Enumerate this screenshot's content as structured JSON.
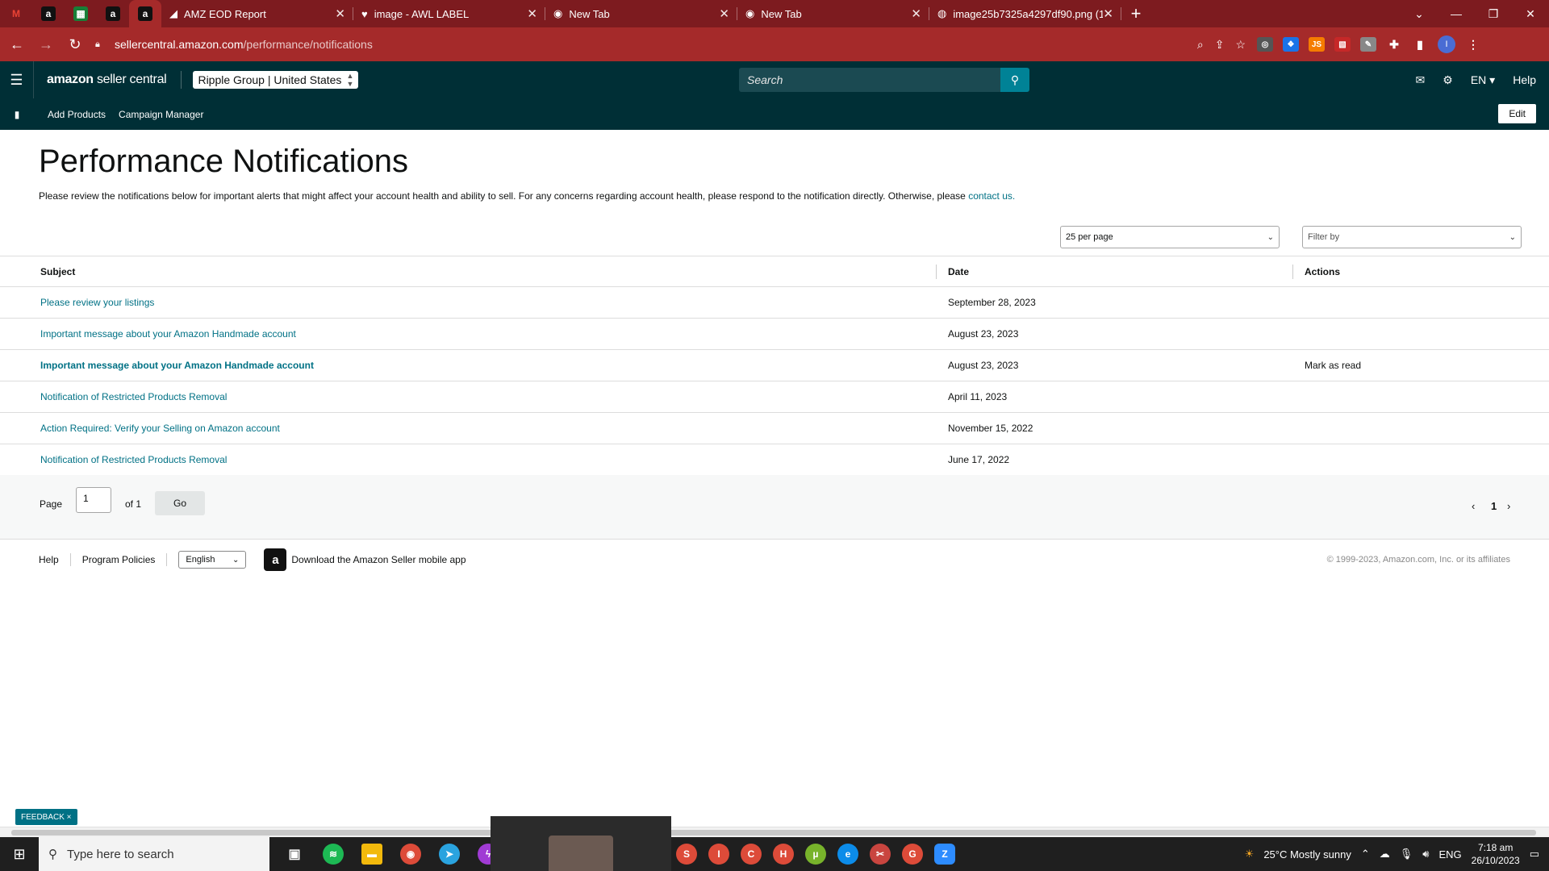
{
  "browser": {
    "pinned_tabs": [
      {
        "icon": "gmail-icon",
        "glyph": "M",
        "color": "#ea4335",
        "bg": "transparent"
      },
      {
        "icon": "amazon-icon",
        "glyph": "a",
        "color": "#fff",
        "bg": "#111"
      },
      {
        "icon": "sheets-icon",
        "glyph": "▦",
        "color": "#fff",
        "bg": "#188038"
      },
      {
        "icon": "amazon-icon",
        "glyph": "a",
        "color": "#fff",
        "bg": "#111"
      },
      {
        "icon": "amazon-icon",
        "glyph": "a",
        "color": "#fff",
        "bg": "#111"
      }
    ],
    "tabs": [
      {
        "title": "AMZ EOD Report",
        "icon": "clickup-icon"
      },
      {
        "title": "image - AWL LABEL",
        "icon": "heart-icon"
      },
      {
        "title": "New Tab",
        "icon": "chrome-icon"
      },
      {
        "title": "New Tab",
        "icon": "chrome-icon"
      },
      {
        "title": "image25b7325a4297df90.png (1",
        "icon": "globe-icon"
      }
    ],
    "url_host": "sellercentral.amazon.com",
    "url_path": "/performance/notifications",
    "profile_initial": "I"
  },
  "header": {
    "logo_bold": "amazon",
    "logo_light": "seller central",
    "account_name": "Ripple Group",
    "account_region": "United States",
    "search_placeholder": "Search",
    "language": "EN",
    "help": "Help"
  },
  "subnav": {
    "links": [
      "Add Products",
      "Campaign Manager"
    ],
    "edit": "Edit"
  },
  "main": {
    "title": "Performance Notifications",
    "description": "Please review the notifications below for important alerts that might affect your account health and ability to sell. For any concerns regarding account health, please respond to the notification directly. Otherwise, please",
    "contact_link": "contact us.",
    "per_page": "25 per page",
    "filter_placeholder": "Filter by",
    "table": {
      "headers": {
        "subject": "Subject",
        "date": "Date",
        "actions": "Actions"
      },
      "rows": [
        {
          "subject": "Please review your listings",
          "date": "September 28, 2023",
          "action": "",
          "unread": false
        },
        {
          "subject": "Important message about your Amazon Handmade account",
          "date": "August 23, 2023",
          "action": "",
          "unread": false
        },
        {
          "subject": "Important message about your Amazon Handmade account",
          "date": "August 23, 2023",
          "action": "Mark as read",
          "unread": true
        },
        {
          "subject": "Notification of Restricted Products Removal",
          "date": "April 11, 2023",
          "action": "",
          "unread": false
        },
        {
          "subject": "Action Required: Verify your Selling on Amazon account",
          "date": "November 15, 2022",
          "action": "",
          "unread": false
        },
        {
          "subject": "Notification of Restricted Products Removal",
          "date": "June 17, 2022",
          "action": "",
          "unread": false
        }
      ]
    },
    "pager": {
      "page_label": "Page",
      "page_value": "1",
      "of_label": "of 1",
      "go": "Go",
      "current": "1"
    }
  },
  "footer": {
    "help": "Help",
    "policies": "Program Policies",
    "language": "English",
    "app_text": "Download the Amazon Seller mobile app",
    "copyright": "© 1999-2023, Amazon.com, Inc. or its affiliates"
  },
  "feedback": "FEEDBACK ×",
  "taskbar": {
    "search_placeholder": "Type here to search",
    "weather": "25°C  Mostly sunny",
    "lang": "ENG",
    "time": "7:18 am",
    "date": "26/10/2023"
  }
}
